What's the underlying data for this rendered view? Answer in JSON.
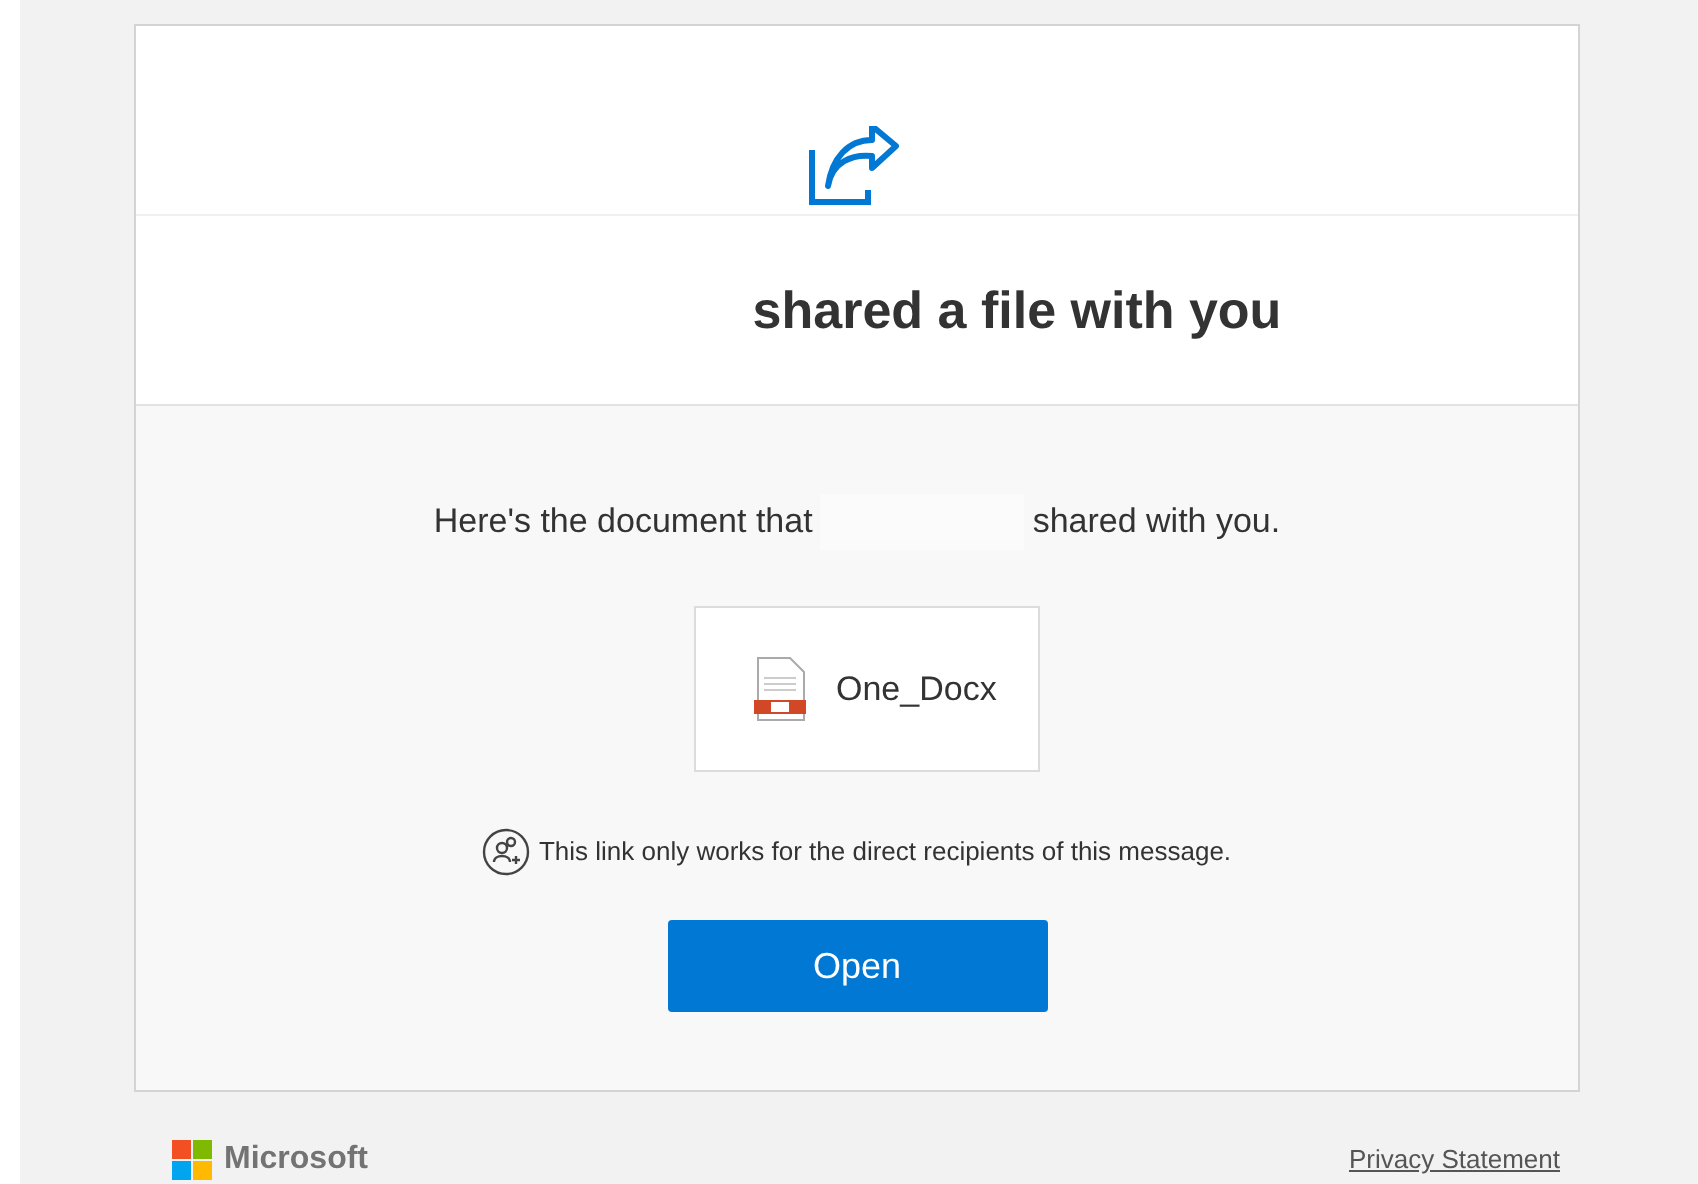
{
  "header": {
    "title": "shared a file with you"
  },
  "message": {
    "before": "Here's the document that",
    "after": "shared with you."
  },
  "file": {
    "name": "One_Docx"
  },
  "notice": "This link only works for the direct recipients of this message.",
  "open_button": "Open",
  "footer": {
    "brand": "Microsoft",
    "privacy_link": "Privacy Statement"
  }
}
